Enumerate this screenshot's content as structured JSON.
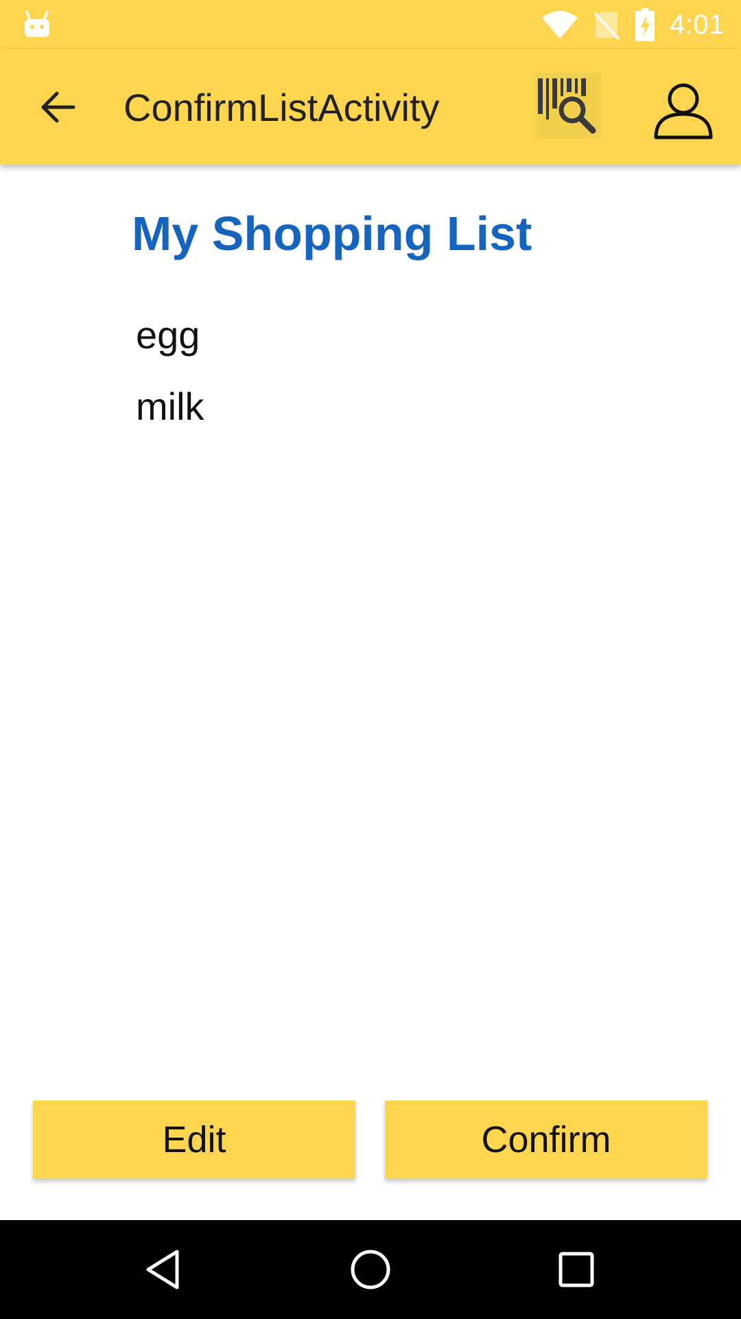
{
  "status_bar": {
    "time": "4:01",
    "icons": [
      "android-notification-icon",
      "wifi-icon",
      "no-sim-icon",
      "battery-charging-icon"
    ]
  },
  "app_bar": {
    "title": "ConfirmListActivity",
    "back_icon": "arrow-back-icon",
    "barcode_icon": "barcode-search-icon",
    "account_icon": "account-icon"
  },
  "main": {
    "heading": "My Shopping List",
    "items": [
      "egg",
      "milk"
    ]
  },
  "actions": {
    "edit_label": "Edit",
    "confirm_label": "Confirm"
  },
  "nav_bar": {
    "icons": [
      "nav-back-icon",
      "nav-home-icon",
      "nav-recents-icon"
    ]
  },
  "colors": {
    "app_bar": "#FDD54F",
    "heading": "#1565C0",
    "button": "#FDD54F",
    "nav_bar": "#000000"
  }
}
